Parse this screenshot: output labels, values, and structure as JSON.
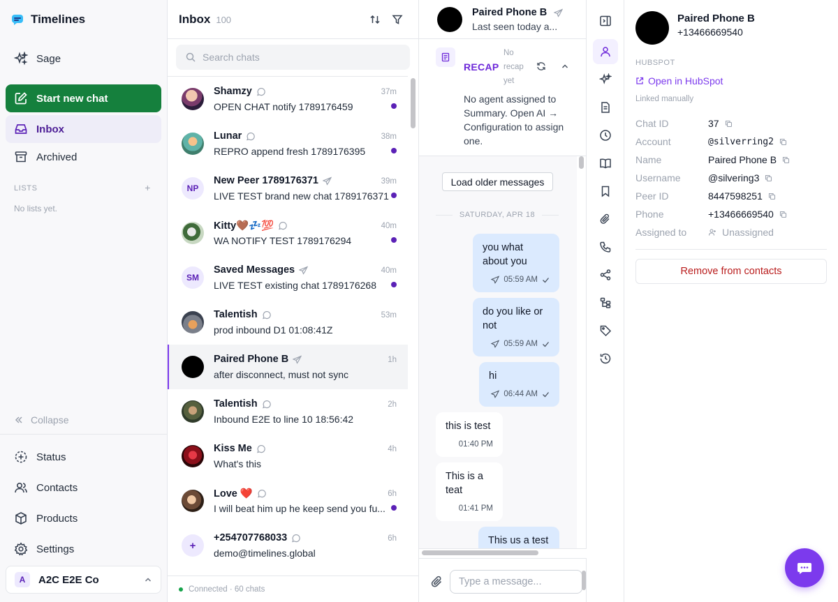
{
  "app": {
    "title": "Timelines"
  },
  "sidebar": {
    "items": [
      {
        "label": "Sage",
        "icon": "sparkles-icon"
      },
      {
        "label": "Start new chat",
        "icon": "edit-icon"
      },
      {
        "label": "Inbox",
        "icon": "inbox-icon"
      },
      {
        "label": "Archived",
        "icon": "archive-icon"
      }
    ],
    "lists_heading": "LISTS",
    "lists_add": "+",
    "lists_empty": "No lists yet.",
    "collapse": "Collapse",
    "bottom_items": [
      {
        "label": "Status",
        "icon": "status-icon"
      },
      {
        "label": "Contacts",
        "icon": "contacts-icon"
      },
      {
        "label": "Products",
        "icon": "box-icon"
      },
      {
        "label": "Settings",
        "icon": "gear-icon"
      }
    ],
    "workspace": {
      "badge": "A",
      "name": "A2C E2E Co"
    }
  },
  "chatlist": {
    "title": "Inbox",
    "count": "100",
    "search_placeholder": "Search chats",
    "chats": [
      {
        "name": "Shamzy",
        "preview": "OPEN CHAT notify 1789176459",
        "time": "37m",
        "unread": true,
        "channel": "whatsapp"
      },
      {
        "name": "Lunar",
        "preview": "REPRO append fresh 1789176395",
        "time": "38m",
        "unread": true,
        "channel": "whatsapp"
      },
      {
        "name": "New Peer 1789176371",
        "preview": "LIVE TEST brand new chat 1789176371",
        "time": "39m",
        "unread": true,
        "channel": "telegram",
        "initials": "NP"
      },
      {
        "name": "Kitty🤎💤💯",
        "preview": "WA NOTIFY TEST 1789176294",
        "time": "40m",
        "unread": true,
        "channel": "whatsapp"
      },
      {
        "name": "Saved Messages",
        "preview": "LIVE TEST existing chat 1789176268",
        "time": "40m",
        "unread": true,
        "channel": "telegram",
        "initials": "SM"
      },
      {
        "name": "Talentish",
        "preview": "prod inbound D1 01:08:41Z",
        "time": "53m",
        "unread": false,
        "channel": "whatsapp"
      },
      {
        "name": "Paired Phone B",
        "preview": "after disconnect, must not sync",
        "time": "1h",
        "unread": false,
        "channel": "telegram",
        "selected": true
      },
      {
        "name": "Talentish",
        "preview": "Inbound E2E to line 10 18:56:42",
        "time": "2h",
        "unread": false,
        "channel": "whatsapp"
      },
      {
        "name": "Kiss Me",
        "preview": "What's this",
        "time": "4h",
        "unread": false,
        "channel": "whatsapp"
      },
      {
        "name": "Love ❤️",
        "preview": "I will beat him up he keep send you fu...",
        "time": "6h",
        "unread": true,
        "channel": "whatsapp"
      },
      {
        "name": "+254707768033",
        "preview": "demo@timelines.global",
        "time": "6h",
        "unread": false,
        "channel": "whatsapp",
        "initials": "+"
      }
    ],
    "footer": "Connected · 60 chats"
  },
  "conversation": {
    "name": "Paired Phone B",
    "last_seen": "Last seen today a...",
    "recap": {
      "label": "RECAP",
      "status": "No recap yet",
      "text": "No agent assigned to Summary. Open AI → Configuration to assign one."
    },
    "load_older": "Load older messages",
    "day_separator": "SATURDAY, APR 18",
    "messages": [
      {
        "dir": "out",
        "text": "you what about you",
        "time": "05:59 AM"
      },
      {
        "dir": "out",
        "text": "do you like or not",
        "time": "05:59 AM"
      },
      {
        "dir": "out",
        "text": "hi",
        "time": "06:44 AM"
      },
      {
        "dir": "in",
        "text": "this is test",
        "time": "01:40 PM"
      },
      {
        "dir": "in",
        "text": "This is a teat",
        "time": "01:41 PM"
      },
      {
        "dir": "out",
        "text": "This us a test",
        "time": ""
      }
    ],
    "composer_placeholder": "Type a message..."
  },
  "rail": {
    "buttons": [
      "panel-toggle-icon",
      "contact-icon",
      "sparkles-icon",
      "document-icon",
      "clock-icon",
      "book-icon",
      "bookmark-icon",
      "paperclip-icon",
      "phone-icon",
      "share-icon",
      "flow-icon",
      "tag-icon",
      "history-icon"
    ]
  },
  "details": {
    "name": "Paired Phone B",
    "phone": "+13466669540",
    "section": "HUBSPOT",
    "open_hubspot": "Open in HubSpot",
    "linked": "Linked manually",
    "fields": [
      {
        "label": "Chat ID",
        "value": "37",
        "copy": true
      },
      {
        "label": "Account",
        "value": "@silverring2",
        "copy": true,
        "mono": true
      },
      {
        "label": "Name",
        "value": "Paired Phone B",
        "copy": true
      },
      {
        "label": "Username",
        "value": "@silvering3",
        "copy": true
      },
      {
        "label": "Peer ID",
        "value": "8447598251",
        "copy": true
      },
      {
        "label": "Phone",
        "value": "+13466669540",
        "copy": true
      },
      {
        "label": "Assigned to",
        "value": "Unassigned",
        "copy": false
      }
    ],
    "remove": "Remove from contacts"
  },
  "colors": {
    "brand": "#15803d",
    "accent": "#7c3aed",
    "unread_dot": "#5b21b6",
    "outgoing_bubble": "#dbeafe",
    "danger": "#b91c1c"
  }
}
